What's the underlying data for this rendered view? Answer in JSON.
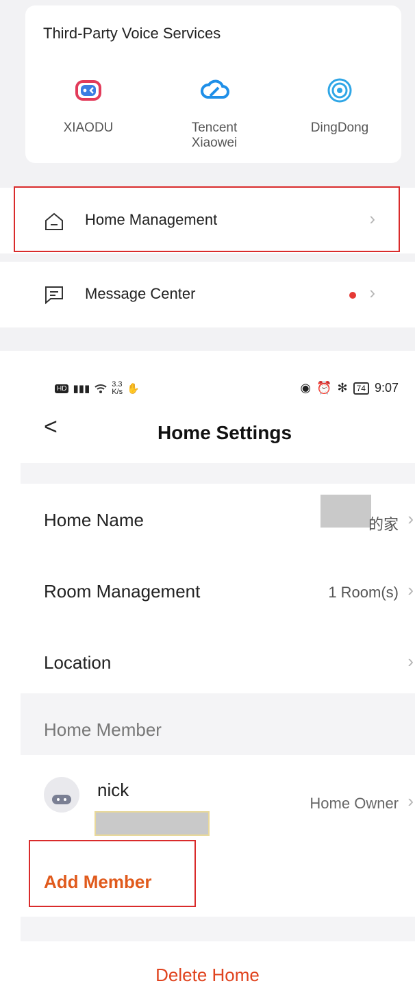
{
  "voice_services": {
    "title": "Third-Party Voice Services",
    "items": [
      {
        "label": "XIAODU",
        "icon": "xiaodu-icon"
      },
      {
        "label": "Tencent\nXiaowei",
        "icon": "tencent-cloud-icon"
      },
      {
        "label": "DingDong",
        "icon": "dingdong-icon"
      }
    ]
  },
  "menu": {
    "home_management": "Home Management",
    "message_center": "Message Center"
  },
  "status_bar": {
    "net_speed_value": "3.3",
    "net_speed_unit": "K/s",
    "battery": "74",
    "time": "9:07"
  },
  "header": {
    "back": "<",
    "title": "Home Settings"
  },
  "settings": {
    "home_name_label": "Home Name",
    "home_name_value": "的家",
    "room_management_label": "Room Management",
    "room_management_value": "1 Room(s)",
    "location_label": "Location"
  },
  "members": {
    "section_title": "Home Member",
    "list": [
      {
        "name": "nick",
        "role": "Home Owner"
      }
    ],
    "add_member": "Add Member"
  },
  "delete_home": "Delete Home",
  "colors": {
    "highlight": "#d92b2b",
    "accent_orange": "#e05a1c",
    "danger": "#e0431e",
    "notification_dot": "#e53935"
  }
}
